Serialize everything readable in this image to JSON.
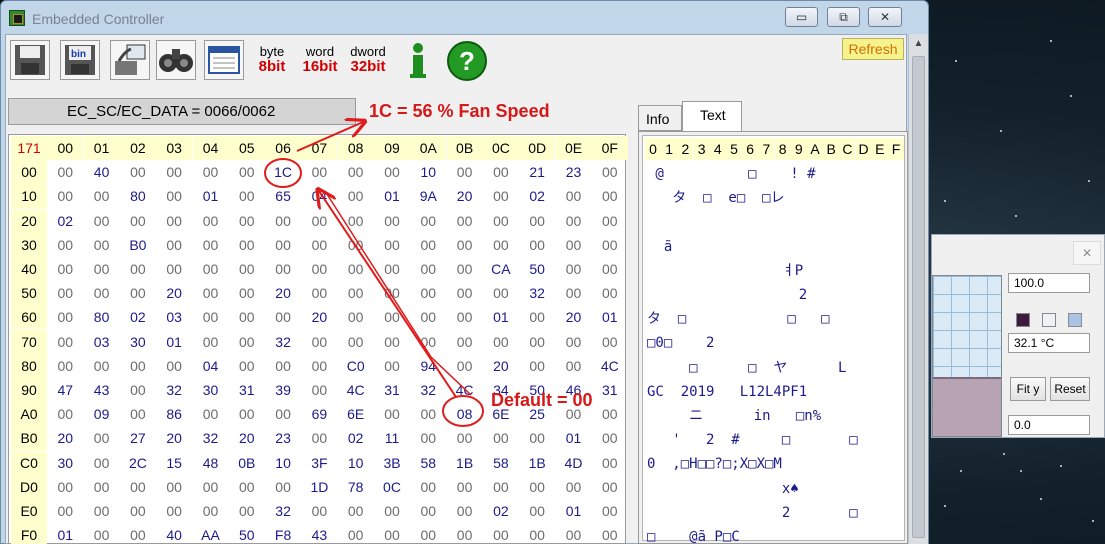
{
  "window": {
    "title": "Embedded Controller",
    "minimize": "▭",
    "maximize": "⧉",
    "close": "✕"
  },
  "toolbar": {
    "buttons": [
      {
        "icon": "save-icon"
      },
      {
        "icon": "save-bin-icon"
      },
      {
        "icon": "network-drive-icon"
      },
      {
        "icon": "binoculars-icon"
      },
      {
        "icon": "window-icon"
      },
      {
        "line1": "byte",
        "line2": "8bit",
        "color": "#d00000"
      },
      {
        "line1": "word",
        "line2": "16bit",
        "color": "#d00000"
      },
      {
        "line1": "dword",
        "line2": "32bit",
        "color": "#d00000"
      },
      {
        "icon": "info-icon"
      },
      {
        "icon": "help-icon"
      }
    ],
    "refresh": "Refresh"
  },
  "ec_data": "EC_SC/EC_DATA = 0066/0062",
  "hex": {
    "corner": "171",
    "cols": [
      "00",
      "01",
      "02",
      "03",
      "04",
      "05",
      "06",
      "07",
      "08",
      "09",
      "0A",
      "0B",
      "0C",
      "0D",
      "0E",
      "0F"
    ],
    "rows": [
      {
        "label": "00",
        "cells": [
          "00",
          "40",
          "00",
          "00",
          "00",
          "00",
          "1C",
          "00",
          "00",
          "00",
          "10",
          "00",
          "00",
          "21",
          "23",
          "00"
        ]
      },
      {
        "label": "10",
        "cells": [
          "00",
          "00",
          "80",
          "00",
          "01",
          "00",
          "65",
          "04",
          "00",
          "01",
          "9A",
          "20",
          "00",
          "02",
          "00",
          "00"
        ]
      },
      {
        "label": "20",
        "cells": [
          "02",
          "00",
          "00",
          "00",
          "00",
          "00",
          "00",
          "00",
          "00",
          "00",
          "00",
          "00",
          "00",
          "00",
          "00",
          "00"
        ]
      },
      {
        "label": "30",
        "cells": [
          "00",
          "00",
          "B0",
          "00",
          "00",
          "00",
          "00",
          "00",
          "00",
          "00",
          "00",
          "00",
          "00",
          "00",
          "00",
          "00"
        ]
      },
      {
        "label": "40",
        "cells": [
          "00",
          "00",
          "00",
          "00",
          "00",
          "00",
          "00",
          "00",
          "00",
          "00",
          "00",
          "00",
          "CA",
          "50",
          "00",
          "00"
        ]
      },
      {
        "label": "50",
        "cells": [
          "00",
          "00",
          "00",
          "20",
          "00",
          "00",
          "20",
          "00",
          "00",
          "00",
          "00",
          "00",
          "00",
          "32",
          "00",
          "00"
        ]
      },
      {
        "label": "60",
        "cells": [
          "00",
          "80",
          "02",
          "03",
          "00",
          "00",
          "00",
          "20",
          "00",
          "00",
          "00",
          "00",
          "01",
          "00",
          "20",
          "01"
        ]
      },
      {
        "label": "70",
        "cells": [
          "00",
          "03",
          "30",
          "01",
          "00",
          "00",
          "32",
          "00",
          "00",
          "00",
          "00",
          "00",
          "00",
          "00",
          "00",
          "00"
        ]
      },
      {
        "label": "80",
        "cells": [
          "00",
          "00",
          "00",
          "00",
          "04",
          "00",
          "00",
          "00",
          "C0",
          "00",
          "94",
          "00",
          "20",
          "00",
          "00",
          "4C"
        ]
      },
      {
        "label": "90",
        "cells": [
          "47",
          "43",
          "00",
          "32",
          "30",
          "31",
          "39",
          "00",
          "4C",
          "31",
          "32",
          "4C",
          "34",
          "50",
          "46",
          "31"
        ]
      },
      {
        "label": "A0",
        "cells": [
          "00",
          "09",
          "00",
          "86",
          "00",
          "00",
          "00",
          "69",
          "6E",
          "00",
          "00",
          "08",
          "6E",
          "25",
          "00",
          "00"
        ]
      },
      {
        "label": "B0",
        "cells": [
          "20",
          "00",
          "27",
          "20",
          "32",
          "20",
          "23",
          "00",
          "02",
          "11",
          "00",
          "00",
          "00",
          "00",
          "01",
          "00"
        ]
      },
      {
        "label": "C0",
        "cells": [
          "30",
          "00",
          "2C",
          "15",
          "48",
          "0B",
          "10",
          "3F",
          "10",
          "3B",
          "58",
          "1B",
          "58",
          "1B",
          "4D",
          "00"
        ]
      },
      {
        "label": "D0",
        "cells": [
          "00",
          "00",
          "00",
          "00",
          "00",
          "00",
          "00",
          "1D",
          "78",
          "0C",
          "00",
          "00",
          "00",
          "00",
          "00",
          "00"
        ]
      },
      {
        "label": "E0",
        "cells": [
          "00",
          "00",
          "00",
          "00",
          "00",
          "00",
          "32",
          "00",
          "00",
          "00",
          "00",
          "00",
          "02",
          "00",
          "01",
          "00"
        ]
      },
      {
        "label": "F0",
        "cells": [
          "01",
          "00",
          "00",
          "40",
          "AA",
          "50",
          "F8",
          "43",
          "00",
          "00",
          "00",
          "00",
          "00",
          "00",
          "00",
          "00"
        ]
      }
    ]
  },
  "tabs": {
    "info": "Info",
    "text": "Text"
  },
  "text_view": {
    "header": [
      "0",
      "1",
      "2",
      "3",
      "4",
      "5",
      "6",
      "7",
      "8",
      "9",
      "A",
      "B",
      "C",
      "D",
      "E",
      "F"
    ],
    "lines": [
      " @          □    ! #",
      "   タ  □  e□  □レ",
      "",
      "  ã",
      "                ㅕP",
      "                  2",
      "タ  □            □   □",
      "□0□    2",
      "     □      □  ヤ      L",
      "GC  2019   L12L4PF1",
      "     ニ      in   □n%",
      "   '   2  #     □       □",
      "0  ,□H□□?□;X□X□M",
      "                x♠",
      "                2       □",
      "□    @ã P□C"
    ]
  },
  "annotations": {
    "fan": "1C = 56 % Fan Speed",
    "default": "Default = 00"
  },
  "plot": {
    "close": "×",
    "max": "100.0",
    "temp": "32.1 °C",
    "min": "0.0",
    "fit": "Fit y",
    "reset": "Reset",
    "swatch_colors": [
      "#3d1a3d",
      "#eef2f5",
      "#a9c4e3"
    ],
    "fill_fraction": 0.37
  }
}
